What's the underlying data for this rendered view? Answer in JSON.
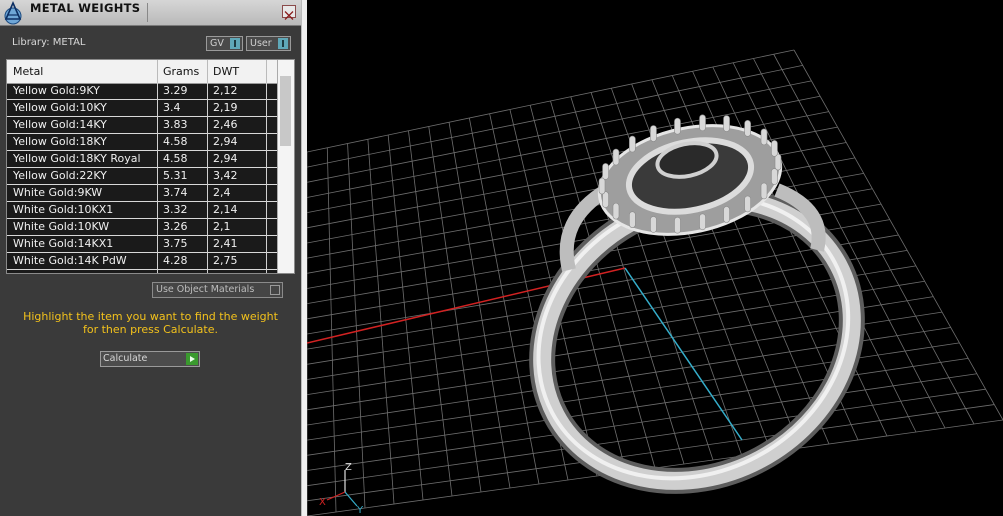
{
  "window": {
    "title": "METAL WEIGHTS"
  },
  "library": {
    "label": "Library: METAL",
    "gv_label": "GV",
    "user_label": "User"
  },
  "table": {
    "headers": [
      "Metal",
      "Grams",
      "DWT"
    ],
    "rows": [
      {
        "metal": "Yellow Gold:9KY",
        "grams": "3.29",
        "dwt": "2,12"
      },
      {
        "metal": "Yellow Gold:10KY",
        "grams": "3.4",
        "dwt": "2,19"
      },
      {
        "metal": "Yellow Gold:14KY",
        "grams": "3.83",
        "dwt": "2,46"
      },
      {
        "metal": "Yellow Gold:18KY",
        "grams": "4.58",
        "dwt": "2,94"
      },
      {
        "metal": "Yellow Gold:18KY Royal",
        "grams": "4.58",
        "dwt": "2,94"
      },
      {
        "metal": "Yellow Gold:22KY",
        "grams": "5.31",
        "dwt": "3,42"
      },
      {
        "metal": "White Gold:9KW",
        "grams": "3.74",
        "dwt": "2,4"
      },
      {
        "metal": "White Gold:10KX1",
        "grams": "3.32",
        "dwt": "2,14"
      },
      {
        "metal": "White Gold:10KW",
        "grams": "3.26",
        "dwt": "2,1"
      },
      {
        "metal": "White Gold:14KX1",
        "grams": "3.75",
        "dwt": "2,41"
      },
      {
        "metal": "White Gold:14K PdW",
        "grams": "4.28",
        "dwt": "2,75"
      }
    ]
  },
  "use_object_materials_label": "Use Object Materials",
  "hint": {
    "line1": "Highlight the item you want to find the weight",
    "line2": "for then press Calculate."
  },
  "calculate_label": "Calculate",
  "viewport": {
    "axis_z": "Z",
    "axis_x": "X",
    "axis_y": "Y"
  },
  "colors": {
    "hint": "#f3c21c",
    "x_axis": "#d22222",
    "y_axis": "#35aecb",
    "grid": "#6e6e6e",
    "ring": "#cfcfcf"
  }
}
